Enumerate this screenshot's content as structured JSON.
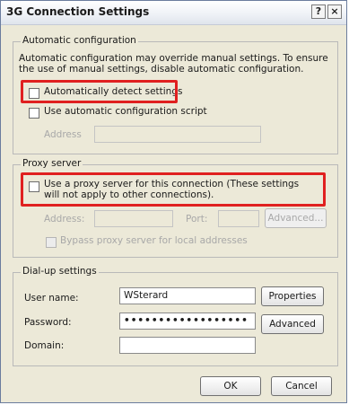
{
  "window": {
    "title": "3G Connection Settings",
    "help_button": "?",
    "close_button": "×"
  },
  "auto_config": {
    "group_label": "Automatic configuration",
    "description": "Automatic configuration may override manual settings.  To ensure the use of manual settings, disable automatic configuration.",
    "detect_label": "Automatically detect settings",
    "detect_checked": false,
    "script_label": "Use automatic configuration script",
    "script_checked": false,
    "address_label": "Address",
    "address_value": ""
  },
  "proxy": {
    "group_label": "Proxy server",
    "use_proxy_label": "Use a proxy server for this connection (These settings will not apply to other connections).",
    "use_proxy_checked": false,
    "address_label": "Address:",
    "address_value": "",
    "port_label": "Port:",
    "port_value": "",
    "advanced_label": "Advanced...",
    "bypass_label": "Bypass proxy server for local addresses",
    "bypass_checked": false
  },
  "dialup": {
    "group_label": "Dial-up settings",
    "username_label": "User name:",
    "username_value": "WSterard",
    "password_label": "Password:",
    "password_value": "••••••••••••••••••",
    "domain_label": "Domain:",
    "domain_value": "",
    "properties_label": "Properties",
    "advanced_label": "Advanced"
  },
  "footer": {
    "ok_label": "OK",
    "cancel_label": "Cancel"
  },
  "colors": {
    "highlight": "#e02020",
    "dialog_bg": "#ece9d8"
  }
}
